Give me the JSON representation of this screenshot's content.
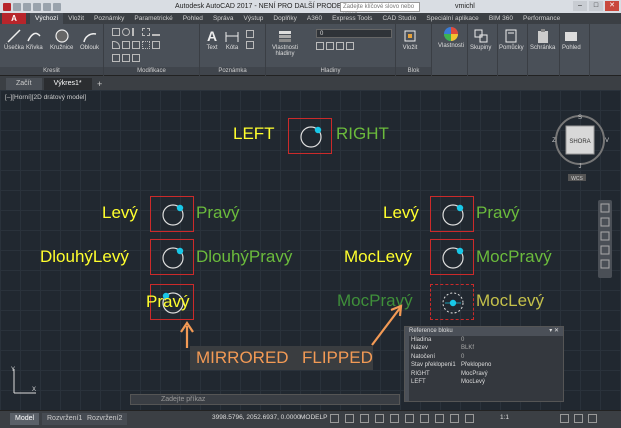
{
  "window": {
    "title": "Autodesk AutoCAD 2017 - NENÍ PRO DALŠÍ PRODEJ   Výkres1.dwg",
    "search_placeholder": "Zadejte klíčové slovo nebo výraz",
    "user": "vmichl"
  },
  "ribbon_tabs": [
    "Výchozí",
    "Vložit",
    "Poznámky",
    "Parametrické",
    "Pohled",
    "Správa",
    "Výstup",
    "Doplňky",
    "A360",
    "Express Tools",
    "CAD Studio",
    "Speciální aplikace",
    "BIM 360",
    "Performance"
  ],
  "ribbon": {
    "draw": {
      "label": "Kreslit",
      "line": "Úsečka",
      "polyline": "Křivka",
      "circle": "Kružnice",
      "arc": "Oblouk"
    },
    "modify": {
      "label": "Modifikace"
    },
    "annotation": {
      "label": "Poznámka",
      "text": "Text",
      "dim": "Kóta"
    },
    "layers": {
      "label": "Hladiny",
      "layer_props": "Vlastnosti hladiny",
      "layer_value": "0"
    },
    "block": {
      "label": "Blok",
      "insert": "Vložit"
    },
    "properties": {
      "label": "Vlastnosti"
    },
    "groups": {
      "label": "Skupiny"
    },
    "utilities": {
      "label": "Pomůcky"
    },
    "clipboard": {
      "label": "Schránka"
    },
    "view": {
      "label": "Pohled"
    }
  },
  "doc_tabs": {
    "start": "Začít",
    "drawing": "Výkres1*"
  },
  "viewport_label": "[–][Horní][2D drátový model]",
  "drawing": {
    "top": {
      "left": "LEFT",
      "right": "RIGHT"
    },
    "rows": [
      {
        "left_a": "Levý",
        "right_a": "Pravý",
        "left_b": "Levý",
        "right_b": "Pravý"
      },
      {
        "left_a": "DlouhýLevý",
        "right_a": "DlouhýPravý",
        "left_b": "MocLevý",
        "right_b": "MocPravý"
      }
    ],
    "mirrored_label": "Pravý",
    "flipped_left": "MocPravý",
    "flipped_right": "MocLevý",
    "annotation_mirrored": "MIRRORED",
    "annotation_flipped": "FLIPPED"
  },
  "viewcube": {
    "top": "S",
    "face": "SHORA",
    "left": "Z",
    "right": "V",
    "bottom": "J",
    "wcs": "WCS"
  },
  "props": {
    "title": "Reference bloku",
    "rows": [
      {
        "k": "Hladina",
        "v": "0"
      },
      {
        "k": "Název",
        "v": "BLKf"
      },
      {
        "k": "Natočení",
        "v": "0"
      },
      {
        "k": "Stav překlopeni1",
        "v": "Překlopeno"
      },
      {
        "k": "RIGHT",
        "v": "MocPravý"
      },
      {
        "k": "LEFT",
        "v": "MocLevý"
      }
    ]
  },
  "command": {
    "placeholder": "Zadejte příkaz"
  },
  "status": {
    "layout_tabs": [
      "Model",
      "Rozvržení1",
      "Rozvržení2"
    ],
    "coords": "3998.5796, 2052.6937, 0.0000",
    "model": "MODELP",
    "scale": "1:1"
  },
  "colors": {
    "yellow": "#ffff2d",
    "green": "#6bbb3c",
    "frame": "#cc2a2a",
    "cyan": "#18c8e8",
    "orange": "#f39a55"
  }
}
